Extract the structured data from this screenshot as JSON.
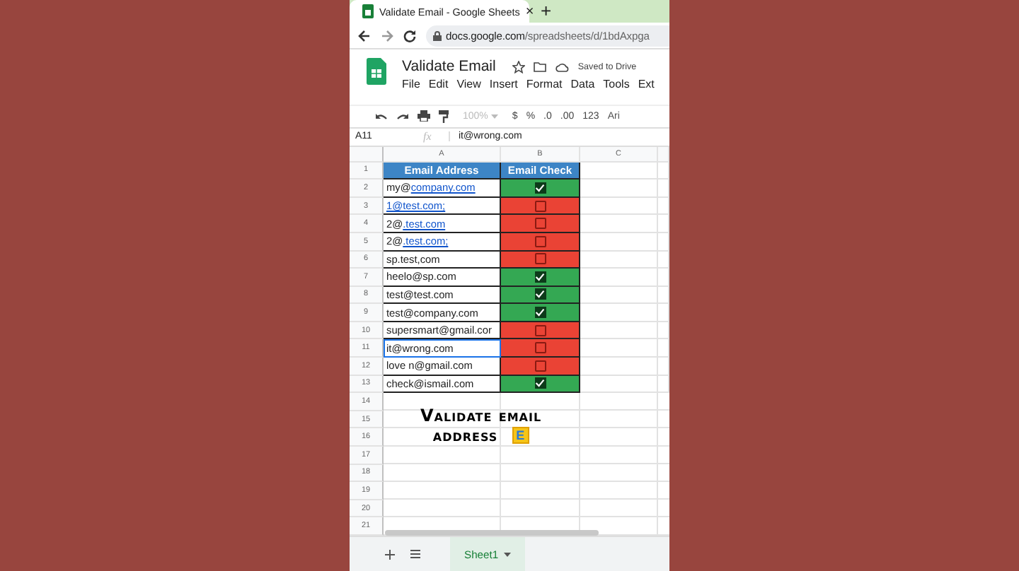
{
  "browser": {
    "tab_title": "Validate Email - Google Sheets",
    "tab_close": "×",
    "new_tab": "+",
    "url_host": "docs.google.com",
    "url_path": "/spreadsheets/d/1bdAxpga"
  },
  "document": {
    "title": "Validate Email",
    "save_status": "Saved to Drive"
  },
  "menu": [
    "File",
    "Edit",
    "View",
    "Insert",
    "Format",
    "Data",
    "Tools",
    "Ext"
  ],
  "toolbar": {
    "zoom": "100%",
    "zoom_disabled": true,
    "items": [
      "$",
      "%",
      ".0",
      ".00",
      "123"
    ],
    "font": "Ari"
  },
  "formula_bar": {
    "cell": "A11",
    "fx": "fx",
    "value": "it@wrong.com"
  },
  "columns": [
    "A",
    "B",
    "C"
  ],
  "header": {
    "number": "1",
    "cells": [
      "Email Address",
      "Email Check"
    ]
  },
  "rows": [
    {
      "number": "2",
      "parts": [
        {
          "text": "my@",
          "link": false
        },
        {
          "text": "company.com",
          "link": true
        }
      ],
      "checked": true,
      "selected": false
    },
    {
      "number": "3",
      "parts": [
        {
          "text": "1@test.com;",
          "link": true
        }
      ],
      "checked": false,
      "selected": false
    },
    {
      "number": "4",
      "parts": [
        {
          "text": "2@",
          "link": false
        },
        {
          "text": ".test.com",
          "link": true
        }
      ],
      "checked": false,
      "selected": false
    },
    {
      "number": "5",
      "parts": [
        {
          "text": "2@",
          "link": false
        },
        {
          "text": ".test.com;",
          "link": true
        }
      ],
      "checked": false,
      "selected": false
    },
    {
      "number": "6",
      "parts": [
        {
          "text": "sp.test,com",
          "link": false
        }
      ],
      "checked": false,
      "selected": false
    },
    {
      "number": "7",
      "parts": [
        {
          "text": "heelo@sp.com",
          "link": false
        }
      ],
      "checked": true,
      "selected": false
    },
    {
      "number": "8",
      "parts": [
        {
          "text": "test@test.com",
          "link": false
        }
      ],
      "checked": true,
      "selected": false
    },
    {
      "number": "9",
      "parts": [
        {
          "text": "test@company.com",
          "link": false
        }
      ],
      "checked": true,
      "selected": false
    },
    {
      "number": "10",
      "parts": [
        {
          "text": "supersmart@gmail.cor",
          "link": false
        }
      ],
      "checked": false,
      "selected": false
    },
    {
      "number": "11",
      "parts": [
        {
          "text": "it@wrong.com",
          "link": false
        }
      ],
      "checked": false,
      "selected": true
    },
    {
      "number": "12",
      "parts": [
        {
          "text": "love n@gmail.com",
          "link": false
        }
      ],
      "checked": false,
      "selected": false
    },
    {
      "number": "13",
      "parts": [
        {
          "text": "check@ismail.com",
          "link": false
        }
      ],
      "checked": true,
      "selected": false
    }
  ],
  "empty_rows": [
    "14",
    "15",
    "16",
    "17",
    "18",
    "19",
    "20",
    "21"
  ],
  "caption": {
    "lines": [
      "Validate email",
      "address"
    ],
    "badge": "E"
  },
  "sheet_tabs": [
    {
      "label": "Sheet1",
      "selected": true
    }
  ]
}
